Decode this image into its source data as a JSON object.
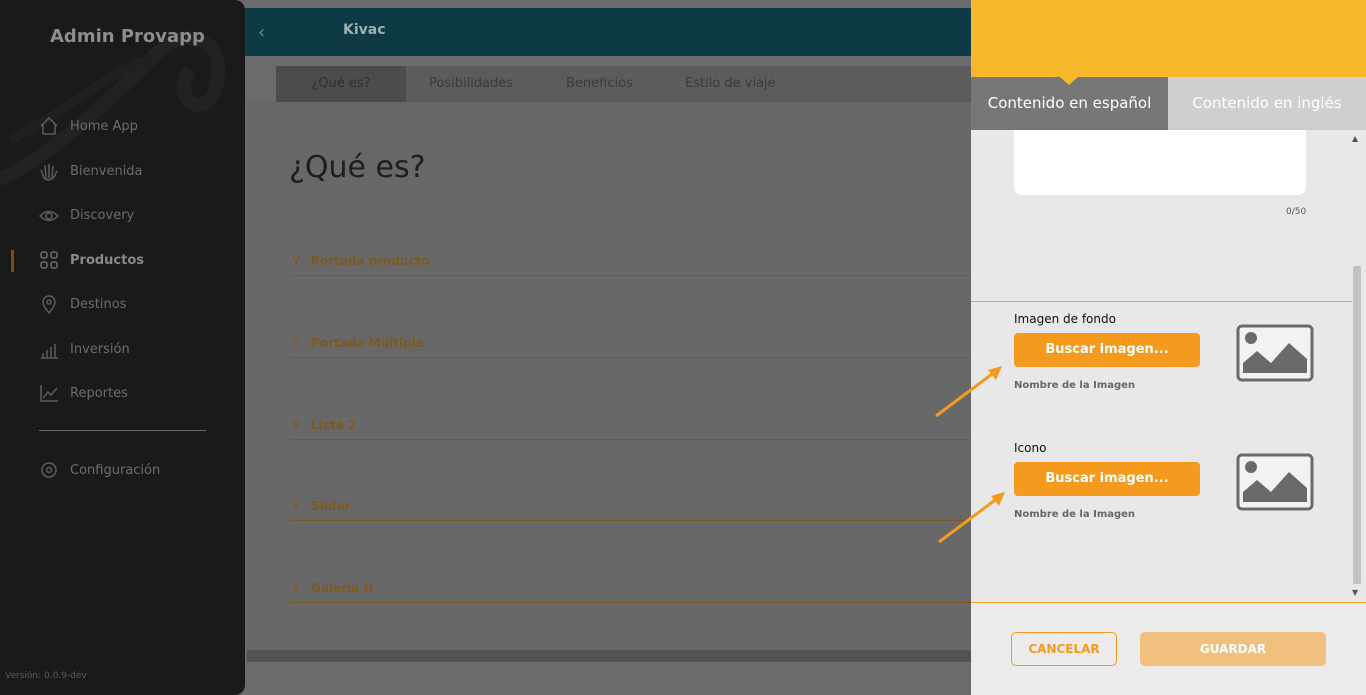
{
  "app": {
    "brand": "Admin Provapp",
    "version": "Versión: 0.0.9-dev"
  },
  "sidebar": {
    "items": [
      {
        "label": "Home App",
        "icon": "home-icon"
      },
      {
        "label": "Bienvenida",
        "icon": "wave-hand-icon"
      },
      {
        "label": "Discovery",
        "icon": "eye-icon"
      },
      {
        "label": "Productos",
        "icon": "grid-icon",
        "active": true
      },
      {
        "label": "Destinos",
        "icon": "location-pin-icon"
      },
      {
        "label": "Inversión",
        "icon": "bar-chart-icon"
      },
      {
        "label": "Reportes",
        "icon": "line-chart-icon"
      },
      {
        "label": "Configuración",
        "icon": "settings-icon"
      }
    ]
  },
  "header": {
    "back_icon": "chevron-left-icon",
    "title": "Kivac"
  },
  "tabs": [
    "¿Qué es?",
    "Posibilidades",
    "Beneficios",
    "Estilo de viaje"
  ],
  "page": {
    "title": "¿Qué es?",
    "sections": [
      "Portada producto",
      "Portada Múltiple",
      "Lista 2",
      "Slider",
      "Galería H"
    ]
  },
  "panel": {
    "tabs": {
      "es": "Contenido en español",
      "en": "Contenido en inglés"
    },
    "counter": "0/50",
    "fields": [
      {
        "label": "Imagen de fondo",
        "button": "Buscar imagen...",
        "image_name": "Nombre de la Imagen"
      },
      {
        "label": "Icono",
        "button": "Buscar imagen...",
        "image_name": "Nombre de la Imagen"
      }
    ],
    "cancel": "CANCELAR",
    "save": "GUARDAR"
  },
  "colors": {
    "accent": "#f49b1f",
    "header": "#f8b82c",
    "sidebar": "#1a1a1a"
  }
}
